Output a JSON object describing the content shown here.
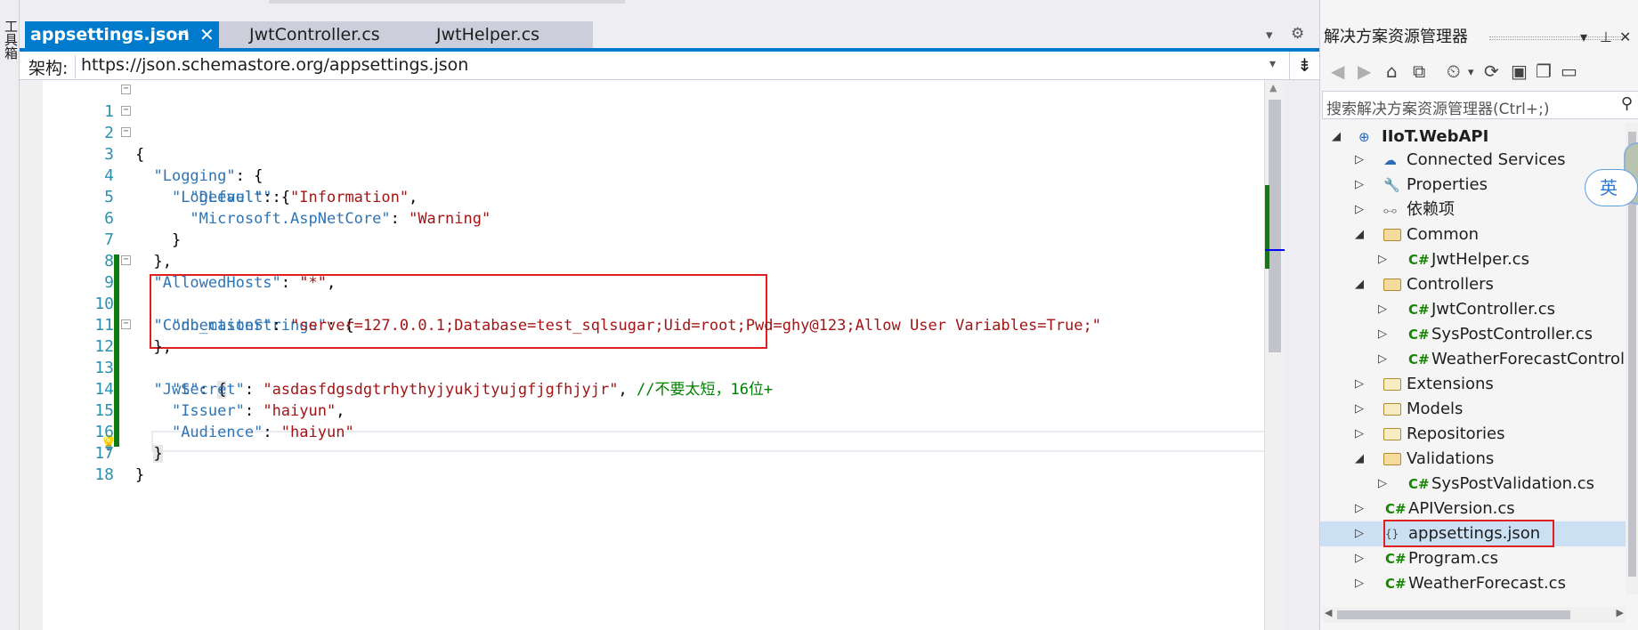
{
  "toolbox": {
    "label": "工具箱"
  },
  "tabs": [
    {
      "label": "appsettings.json",
      "active": true
    },
    {
      "label": "JwtController.cs",
      "active": false
    },
    {
      "label": "JwtHelper.cs",
      "active": false
    }
  ],
  "schema": {
    "label": "架构:",
    "value": "https://json.schemastore.org/appsettings.json"
  },
  "editor": {
    "line_numbers": [
      "1",
      "2",
      "3",
      "4",
      "5",
      "6",
      "7",
      "8",
      "9",
      "10",
      "11",
      "12",
      "13",
      "14",
      "15",
      "16",
      "17",
      "18"
    ]
  },
  "solution_explorer": {
    "title": "解决方案资源管理器",
    "search_placeholder": "搜索解决方案资源管理器(Ctrl+;)",
    "project": "IIoT.WebAPI",
    "items": [
      {
        "label": "Connected Services"
      },
      {
        "label": "Properties"
      },
      {
        "label": "依赖项"
      },
      {
        "label": "Common"
      },
      {
        "label": "JwtHelper.cs"
      },
      {
        "label": "Controllers"
      },
      {
        "label": "JwtController.cs"
      },
      {
        "label": "SysPostController.cs"
      },
      {
        "label": "WeatherForecastControl"
      },
      {
        "label": "Extensions"
      },
      {
        "label": "Models"
      },
      {
        "label": "Repositories"
      },
      {
        "label": "Validations"
      },
      {
        "label": "SysPostValidation.cs"
      },
      {
        "label": "APIVersion.cs"
      },
      {
        "label": "appsettings.json"
      },
      {
        "label": "Program.cs"
      },
      {
        "label": "WeatherForecast.cs"
      }
    ],
    "cs_badge": "C#",
    "json_badge": "{}"
  },
  "ime": {
    "label": "英"
  },
  "colors": {
    "accent": "#007acc",
    "highlight_box": "#e02020",
    "change_bar": "#107c10"
  }
}
